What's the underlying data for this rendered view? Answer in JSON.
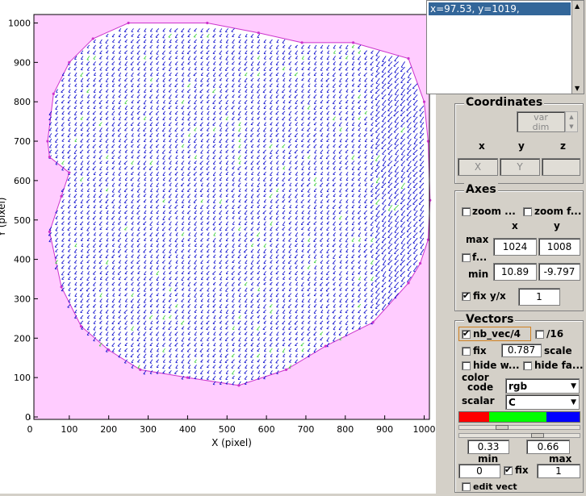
{
  "plot": {
    "xlabel": "X (pixel)",
    "ylabel": "Y (pixel)",
    "xticks": [
      "0",
      "100",
      "200",
      "300",
      "400",
      "500",
      "600",
      "700",
      "800",
      "900",
      "1000"
    ],
    "yticks": [
      "0",
      "100",
      "200",
      "300",
      "400",
      "500",
      "600",
      "700",
      "800",
      "900",
      "1000"
    ],
    "background_color": "#ffccff",
    "mask_color": "#ffffff",
    "border_color": "#cc33cc",
    "vector_color": "#0000cc",
    "vector_alt_color": "#33cc33"
  },
  "coord_readout": {
    "text": "x=97.53, y=1019,"
  },
  "coordinates": {
    "title": "Coordinates",
    "var_dim_label": "var\ndim",
    "col_x": "x",
    "col_y": "y",
    "col_z": "z",
    "field_x": "X",
    "field_y": "Y",
    "field_z": ""
  },
  "axes": {
    "title": "Axes",
    "zoom_label": "zoom ...",
    "zoom_fix_label": "zoom f...",
    "col_x": "x",
    "col_y": "y",
    "max_label": "max",
    "max_x": "1024",
    "max_y": "1008",
    "fix_label": "f...",
    "min_label": "min",
    "min_x": "10.89",
    "min_y": "-9.797",
    "fix_yx_label": "fix y/x",
    "fix_yx_value": "1"
  },
  "vectors": {
    "title": "Vectors",
    "nb_vec_label": "nb_vec/4",
    "sixteen_label": "/16",
    "fix_label": "fix",
    "scale_value": "0.787",
    "scale_label": "scale",
    "hide_w_label": "hide w...",
    "hide_fa_label": "hide fa...",
    "color_label": "color",
    "code_label": "code",
    "code_value": "rgb",
    "scalar_label": "scalar",
    "scalar_value": "C",
    "color_bar": [
      "#ff0000",
      "#00ff00",
      "#0000ff"
    ],
    "slider1_pos": 0.33,
    "slider2_pos": 0.66,
    "range_low": "0.33",
    "range_high": "0.66",
    "min_label": "min",
    "max_label": "max",
    "min_value": "0",
    "max_value": "1",
    "fix_range_label": "fix",
    "edit_vect_label": "edit vect"
  }
}
